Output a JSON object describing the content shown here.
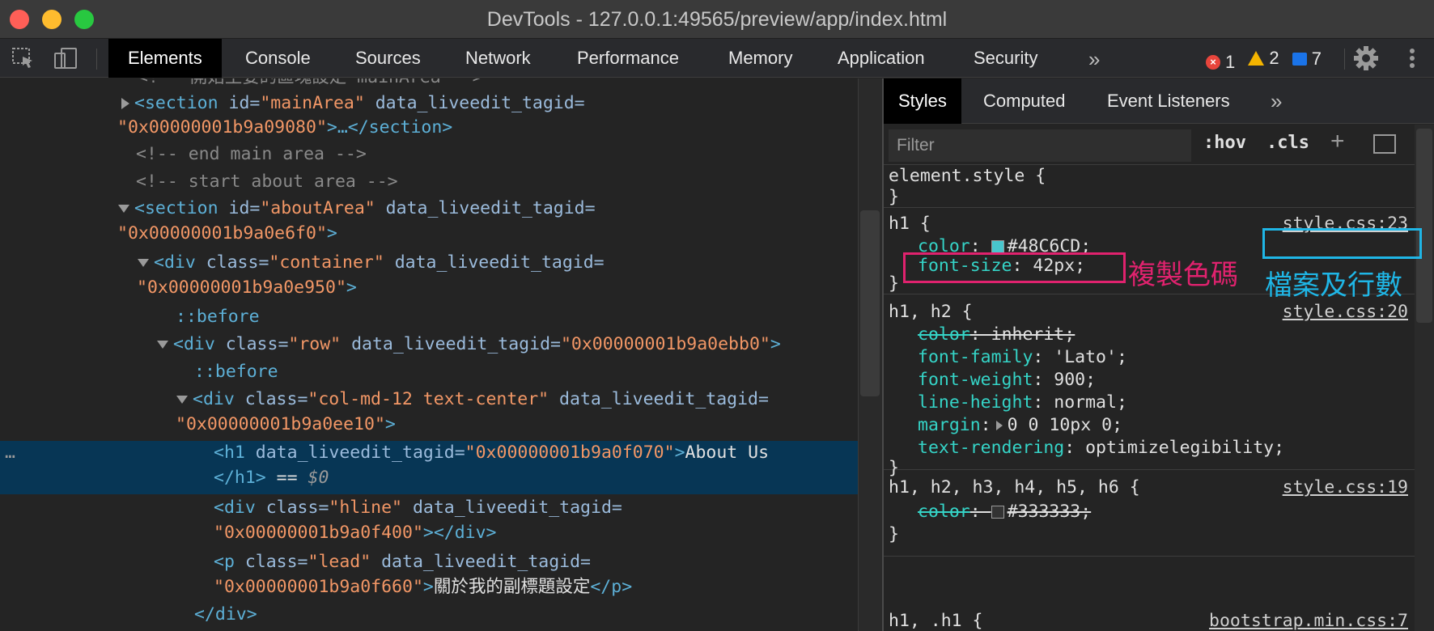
{
  "window": {
    "title": "DevTools - 127.0.0.1:49565/preview/app/index.html"
  },
  "toolbar": {
    "tabs": [
      "Elements",
      "Console",
      "Sources",
      "Network",
      "Performance",
      "Memory",
      "Application",
      "Security"
    ],
    "more": "»",
    "counts": {
      "errors": "1",
      "warnings": "2",
      "messages": "7"
    }
  },
  "dom": {
    "lines": [
      {
        "a": "<!-- ",
        "b": "開始主要的區塊設定 mainArea",
        "c": " -->"
      },
      {
        "tag1": "<section",
        "attr1": " id=",
        "val1": "\"mainArea\"",
        "attr2": " data_liveedit_tagid="
      },
      {
        "val": "\"0x00000001b9a09080\"",
        "tag": ">…</section>"
      },
      {
        "cmt": "<!-- end main area -->"
      },
      {
        "cmt": "<!-- start about area -->"
      },
      {
        "tag1": "<section",
        "attr1": " id=",
        "val1": "\"aboutArea\"",
        "attr2": " data_liveedit_tagid="
      },
      {
        "val": "\"0x00000001b9a0e6f0\"",
        "tag": ">"
      },
      {
        "tag1": "<div",
        "attr1": " class=",
        "val1": "\"container\"",
        "attr2": " data_liveedit_tagid="
      },
      {
        "val": "\"0x00000001b9a0e950\"",
        "tag": ">"
      },
      {
        "pseudo": "::before"
      },
      {
        "tag1": "<div",
        "attr1": " class=",
        "val1": "\"row\"",
        "attr2": " data_liveedit_tagid=",
        "val2": "\"0x00000001b9a0ebb0\"",
        "tag2": ">"
      },
      {
        "pseudo": "::before"
      },
      {
        "tag1": "<div",
        "attr1": " class=",
        "val1": "\"col-md-12 text-center\"",
        "attr2": " data_liveedit_tagid="
      },
      {
        "val": "\"0x00000001b9a0ee10\"",
        "tag": ">"
      },
      {
        "tag1": "<h1",
        "attr1": " data_liveedit_tagid=",
        "val1": "\"0x00000001b9a0f070\"",
        "tag2": ">",
        "text": "About Us"
      },
      {
        "tag": "</h1>",
        "eq": " == ",
        "dollar": "$0"
      },
      {
        "tag1": "<div",
        "attr1": " class=",
        "val1": "\"hline\"",
        "attr2": " data_liveedit_tagid="
      },
      {
        "val": "\"0x00000001b9a0f400\"",
        "tag": "></div>"
      },
      {
        "tag1": "<p",
        "attr1": " class=",
        "val1": "\"lead\"",
        "attr2": " data_liveedit_tagid="
      },
      {
        "val": "\"0x00000001b9a0f660\"",
        "tag": ">",
        "text": "關於我的副標題設定",
        "tag2": "</p>"
      },
      {
        "tag": "</div>"
      }
    ],
    "row_dots": "…"
  },
  "styles": {
    "tabs": [
      "Styles",
      "Computed",
      "Event Listeners"
    ],
    "more": "»",
    "filter_placeholder": "Filter",
    "hov": ":hov",
    "cls": ".cls",
    "plus": "+",
    "rules": [
      {
        "selector": "element.style {",
        "close": "}"
      },
      {
        "selector": "h1 {",
        "source": "style.css:23",
        "close": "}",
        "props": [
          {
            "name": "color",
            "value": "#48C6CD;",
            "swatch": "#48c6cd"
          },
          {
            "name": "font-size",
            "value": "42px;"
          }
        ]
      },
      {
        "selector": "h1, h2 {",
        "source": "style.css:20",
        "close": "}",
        "props": [
          {
            "name": "color",
            "value": "inherit;",
            "struck": true
          },
          {
            "name": "font-family",
            "value": "'Lato';"
          },
          {
            "name": "font-weight",
            "value": "900;"
          },
          {
            "name": "line-height",
            "value": "normal;"
          },
          {
            "name": "margin",
            "value": "0 0 10px 0;"
          },
          {
            "name": "text-rendering",
            "value": "optimizelegibility;"
          }
        ]
      },
      {
        "selector": "h1, h2, h3, h4, h5, h6 {",
        "source": "style.css:19",
        "close": "}",
        "props": [
          {
            "name": "color",
            "value": "#333333;",
            "struck": true,
            "swatch": "#333333"
          }
        ]
      },
      {
        "selector": "h1, .h1 {",
        "source": "bootstrap.min.css:7"
      }
    ]
  },
  "annotations": {
    "copy_color": "複製色碼",
    "file_line": "檔案及行數"
  },
  "colors": {
    "accent_pink": "#e0226e",
    "accent_cyan": "#1fb6e6",
    "selection": "#073655"
  }
}
